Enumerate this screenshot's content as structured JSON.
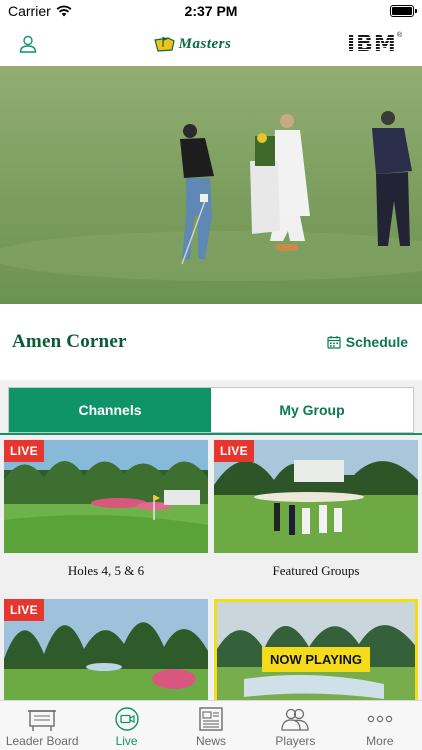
{
  "status_bar": {
    "carrier": "Carrier",
    "time": "2:37 PM",
    "battery_level": 1.0
  },
  "header": {
    "logo_text": "Masters",
    "sponsor_logo": "IBM",
    "sponsor_mark": "®"
  },
  "video": {
    "icons": [
      "golf-video-frame"
    ]
  },
  "title_row": {
    "channel_title": "Amen Corner",
    "schedule_label": "Schedule"
  },
  "tabs": {
    "channels_label": "Channels",
    "my_group_label": "My Group",
    "active": "Channels"
  },
  "tiles": [
    {
      "label": "Holes 4, 5 & 6",
      "badge": "LIVE"
    },
    {
      "label": "Featured Groups",
      "badge": "LIVE"
    },
    {
      "label": "",
      "badge": "LIVE"
    },
    {
      "label": "",
      "badge": "NOW PLAYING"
    }
  ],
  "tab_bar": [
    {
      "label": "Leader Board",
      "icon": "leaderboard-icon"
    },
    {
      "label": "Live",
      "icon": "video-camera-icon"
    },
    {
      "label": "News",
      "icon": "newspaper-icon"
    },
    {
      "label": "Players",
      "icon": "players-icon"
    },
    {
      "label": "More",
      "icon": "more-dots-icon"
    }
  ],
  "colors": {
    "accent": "#0f9467",
    "title_green": "#0a5a35",
    "live_red": "#e5372f",
    "now_playing_yellow": "#f5dc1a"
  }
}
